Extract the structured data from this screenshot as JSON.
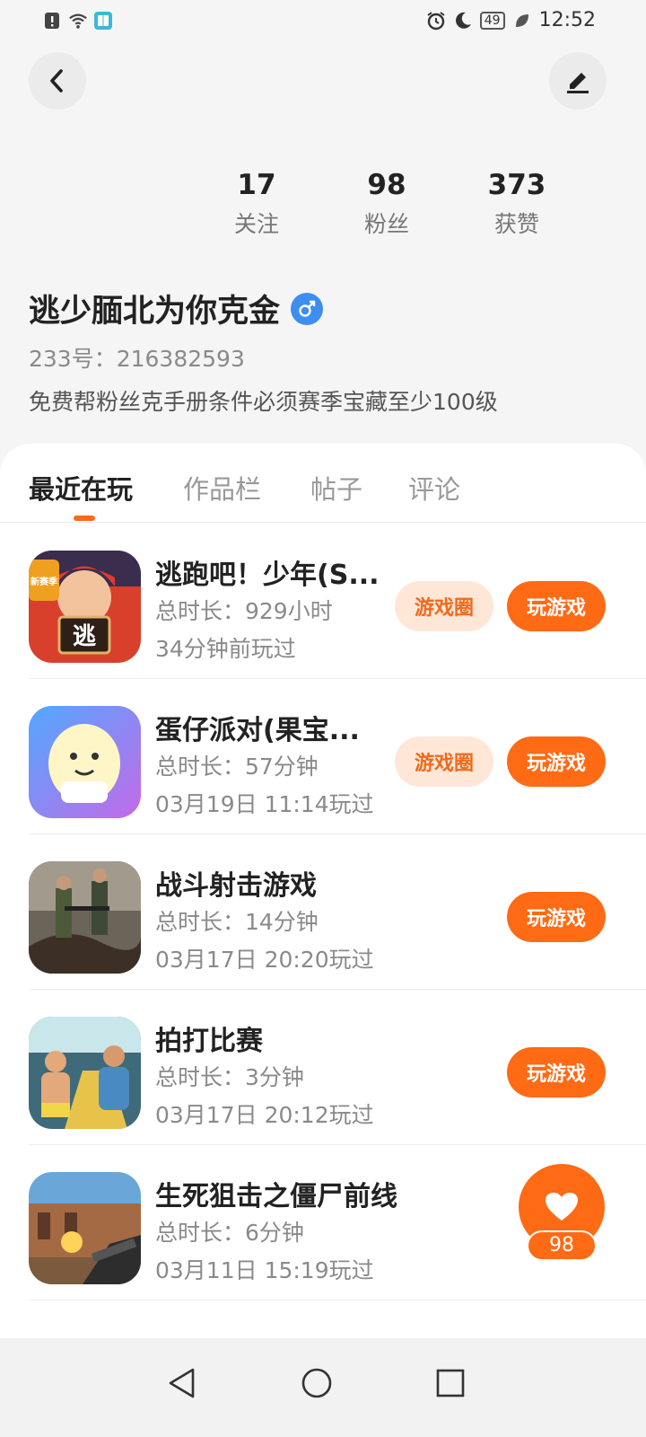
{
  "status_bar": {
    "time": "12:52",
    "battery": "49"
  },
  "stats": [
    {
      "value": "17",
      "label": "关注"
    },
    {
      "value": "98",
      "label": "粉丝"
    },
    {
      "value": "373",
      "label": "获赞"
    }
  ],
  "profile": {
    "nickname": "逃少腼北为你克金",
    "uid": "233号：216382593",
    "bio": "免费帮粉丝克手册条件必须赛季宝藏至少100级"
  },
  "tabs": [
    "最近在玩",
    "作品栏",
    "帖子",
    "评论"
  ],
  "games": [
    {
      "title": "逃跑吧！少年(S...",
      "duration": "总时长：929小时",
      "last_played": "34分钟前玩过",
      "circle_label": "游戏圈",
      "play_label": "玩游戏",
      "icon_text": "逃",
      "icon_badge": "新赛季"
    },
    {
      "title": "蛋仔派对(果宝...",
      "duration": "总时长：57分钟",
      "last_played": "03月19日 11:14玩过",
      "circle_label": "游戏圈",
      "play_label": "玩游戏"
    },
    {
      "title": "战斗射击游戏",
      "duration": "总时长：14分钟",
      "last_played": "03月17日 20:20玩过",
      "play_label": "玩游戏"
    },
    {
      "title": "拍打比赛",
      "duration": "总时长：3分钟",
      "last_played": "03月17日 20:12玩过",
      "play_label": "玩游戏"
    },
    {
      "title": "生死狙击之僵尸前线",
      "duration": "总时长：6分钟",
      "last_played": "03月11日 15:19玩过"
    }
  ],
  "like_float": {
    "count": "98"
  },
  "colors": {
    "accent": "#ff6a14",
    "accent_soft": "#ffe7d8",
    "gender_male": "#3d8eee"
  },
  "icons": [
    "back-arrow-icon",
    "edit-icon",
    "male-icon",
    "heart-icon",
    "nav-back-icon",
    "nav-home-icon",
    "nav-recents-icon"
  ]
}
